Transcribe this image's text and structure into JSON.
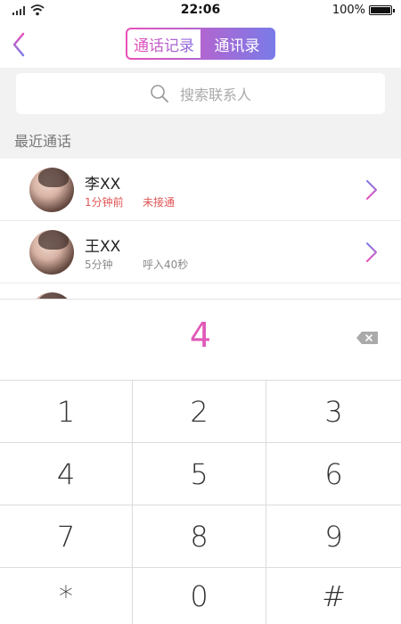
{
  "status": {
    "time": "22:06",
    "battery": "100%"
  },
  "nav": {
    "tabs": [
      "通话记录",
      "通讯录"
    ]
  },
  "search": {
    "placeholder": "搜索联系人"
  },
  "section": {
    "title": "最近通话"
  },
  "contacts": [
    {
      "name": "李XX",
      "time": "1分钟前",
      "status": "未接通"
    },
    {
      "name": "王XX",
      "time": "5分钟",
      "status": "呼入40秒"
    }
  ],
  "dialer": {
    "input": "4",
    "keys": [
      "1",
      "2",
      "3",
      "4",
      "5",
      "6",
      "7",
      "8",
      "9",
      "*",
      "0",
      "#"
    ]
  },
  "colors": {
    "accent_pink": "#e94fb8",
    "accent_purple": "#7a7be8",
    "missed_red": "#e05555"
  }
}
